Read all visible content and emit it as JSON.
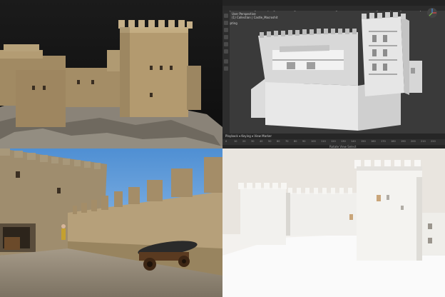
{
  "image": {
    "title": "",
    "panels": [
      {
        "id": "scan",
        "description": "photogrammetry castle model"
      },
      {
        "id": "blender",
        "description": "blender viewport cutaway"
      },
      {
        "id": "render",
        "description": "castle wall walk render with cannon"
      },
      {
        "id": "print",
        "description": "white 3D printed castle"
      }
    ]
  },
  "blender": {
    "menu_tabs": [
      "Layout",
      "Modeling",
      "Sculpting",
      "UV Editing",
      "Texture Paint",
      "Shading",
      "Animation",
      "Rendering",
      "Compositing",
      "Geometry Nodes",
      "Scripting"
    ],
    "active_tab": "Layout",
    "viewport_info_line1": "User Perspective",
    "viewport_info_line2": "(1) Collection | Castle_Macroshit",
    "timeline_controls": "Playback ▾  Keying ▾  View  Marker",
    "timeline_ticks": [
      "0",
      "10",
      "20",
      "30",
      "40",
      "50",
      "60",
      "70",
      "80",
      "90",
      "100",
      "110",
      "120",
      "130",
      "140",
      "150",
      "160",
      "170",
      "180",
      "190",
      "200",
      "210",
      "220",
      "230",
      "240",
      "250"
    ],
    "status_text": "Rotate View   Select"
  }
}
